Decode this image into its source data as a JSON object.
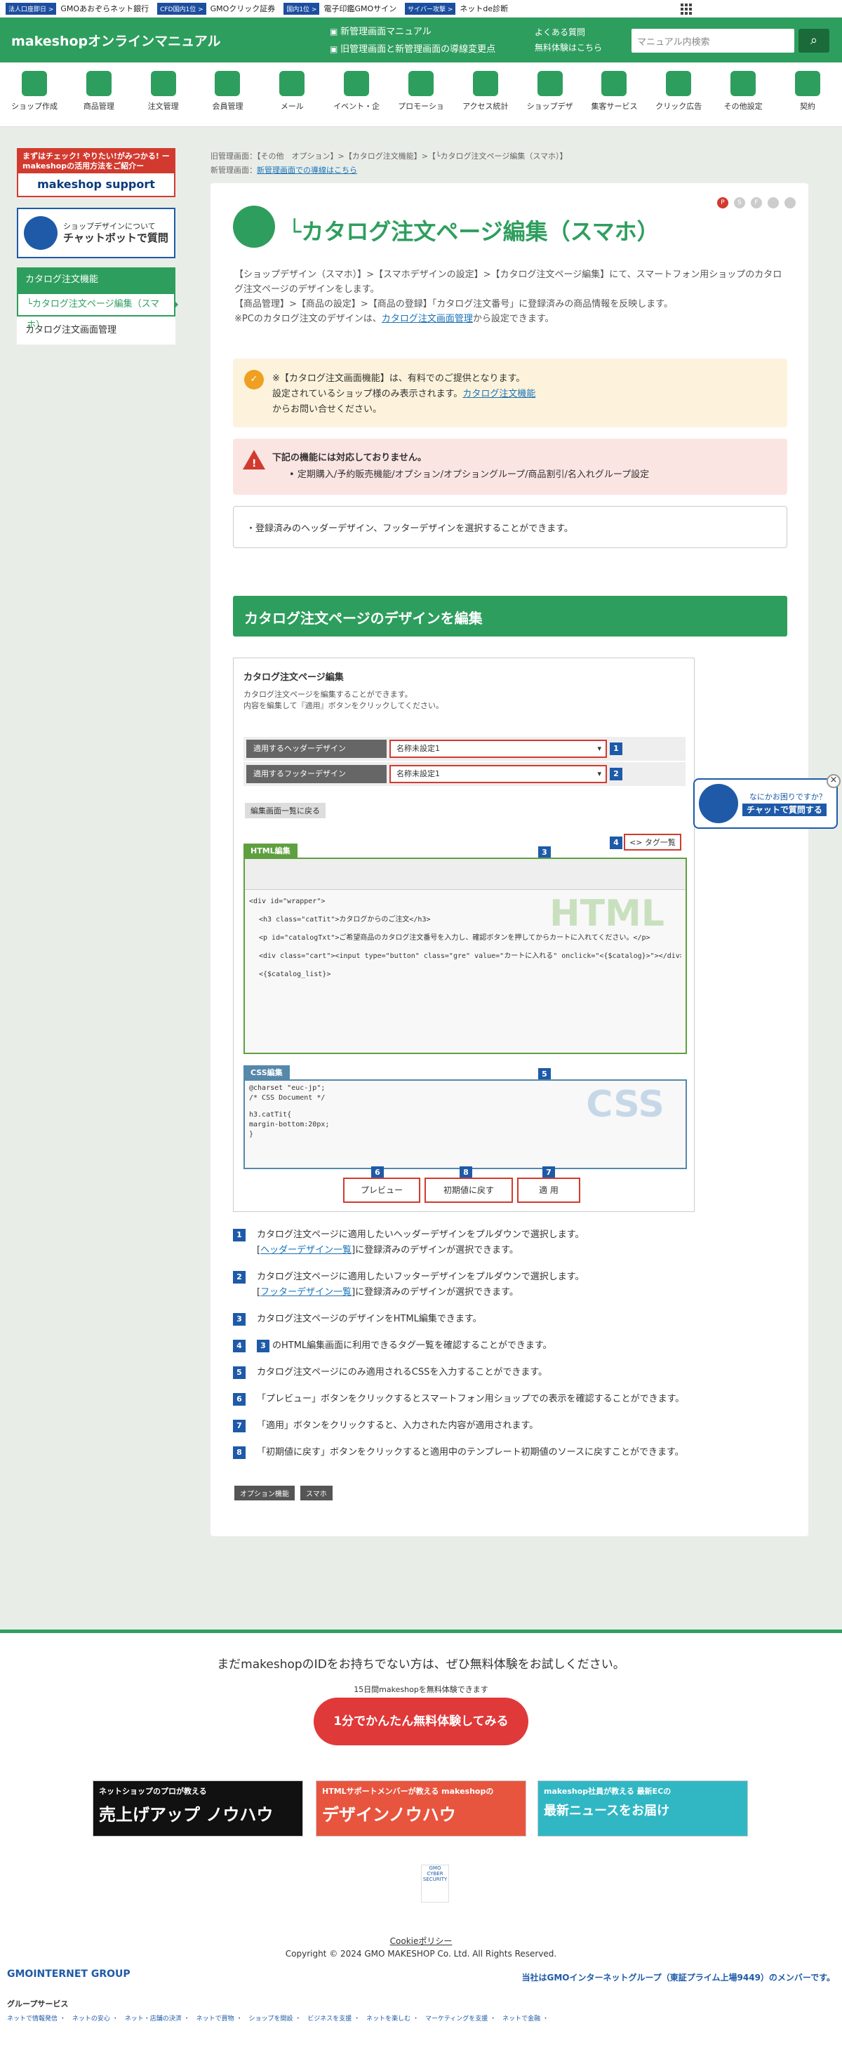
{
  "topbar": {
    "items": [
      {
        "badge": "法人口座即日 >",
        "text": "GMOあおぞらネット銀行"
      },
      {
        "badge": "CFD国内1位 >",
        "text": "GMOクリック証券"
      },
      {
        "badge": "国内1位 >",
        "text": "電子印鑑GMOサイン"
      },
      {
        "badge": "サイバー攻撃 >",
        "text": "ネットde診断"
      }
    ]
  },
  "header": {
    "logo": "makeshopオンラインマニュアル",
    "link1": "新管理画面マニュアル",
    "link2": "旧管理画面と新管理画面の導線変更点",
    "faq": "よくある質問",
    "trial": "無料体験はこちら",
    "search_placeholder": "マニュアル内検索"
  },
  "nav": [
    "ショップ作成",
    "商品管理",
    "注文管理",
    "会員管理",
    "メール",
    "イベント・企",
    "プロモーショ",
    "アクセス統計",
    "ショップデザ",
    "集客サービス",
    "クリック広告",
    "その他設定",
    "契約"
  ],
  "sidebar": {
    "banner1_top": "まずはチェック! やりたい!がみつかる! ー makeshopの活用方法をご紹介ー",
    "banner1_logo": "makeshop support",
    "banner2_line1": "ショップデザインについて",
    "banner2_line2": "チャットボットで質問",
    "menu_head": "カタログ注文機能",
    "menu_active": "└カタログ注文ページ編集（スマホ）",
    "menu_item": "カタログ注文画面管理"
  },
  "breadcrumb": {
    "line1": "旧管理画面：【その他　オプション】>【カタログ注文機能】>【└カタログ注文ページ編集（スマホ）】",
    "line2_prefix": "新管理画面：",
    "line2_link": "新管理画面での導線はこちら"
  },
  "page": {
    "title": "└カタログ注文ページ編集（スマホ）",
    "desc1": "【ショップデザイン（スマホ）】>【スマホデザインの設定】>【カタログ注文ページ編集】にて、スマートフォン用ショップのカタログ注文ページのデザインをします。",
    "desc2": "【商品管理】>【商品の設定】>【商品の登録】「カタログ注文番号」に登録済みの商品情報を反映します。",
    "desc3_prefix": "※PCのカタログ注文のデザインは、",
    "desc3_link": "カタログ注文画面管理",
    "desc3_suffix": "から設定できます。",
    "note1_l1": "※【カタログ注文画面機能】は、有料でのご提供となります。",
    "note1_l2": "設定されているショップ様のみ表示されます。",
    "note1_link": "カタログ注文機能",
    "note1_l3": "からお問い合せください。",
    "note2_title": "下記の機能には対応しておりません。",
    "note2_item": "定期購入/予約販売機能/オプション/オプショングループ/商品割引/名入れグループ設定",
    "note3": "・登録済みのヘッダーデザイン、フッターデザインを選択することができます。",
    "section": "カタログ注文ページのデザインを編集"
  },
  "shot": {
    "title": "カタログ注文ページ編集",
    "desc1": "カタログ注文ページを編集することができます。",
    "desc2": "内容を編集して『適用』ボタンをクリックしてください。",
    "hlabel": "適用するヘッダーデザイン",
    "hval": "名称未設定1",
    "flabel": "適用するフッターデザイン",
    "fval": "名称未設定1",
    "back": "編集画面一覧に戻る",
    "html_tab": "HTML編集",
    "tag_list": "<> タグ一覧",
    "html_bg": "HTML",
    "code1": "<div id=\"wrapper\">",
    "code2": "<h3 class=\"catTit\">カタログからのご注文</h3>",
    "code3": "<p id=\"catalogTxt\">ご希望商品のカタログ注文番号を入力し、確認ボタンを押してからカートに入れてください。</p>",
    "code4": "<div class=\"cart\"><input type=\"button\" class=\"gre\" value=\"カートに入れる\" onclick=\"<{$catalog}>\"></div>",
    "code5": "<{$catalog_list}>",
    "css_tab": "CSS編集",
    "css_bg": "CSS",
    "css1": "@charset \"euc-jp\";",
    "css2": "/* CSS Document */",
    "css3": "h3.catTit{",
    "css4": "  margin-bottom:20px;",
    "css5": "}",
    "preview": "プレビュー",
    "reset": "初期値に戻す",
    "apply": "適 用"
  },
  "steps": [
    {
      "n": "1",
      "t": "カタログ注文ページに適用したいヘッダーデザインをプルダウンで選択します。",
      "l": "ヘッダーデザイン一覧",
      "s": "に登録済みのデザインが選択できます。"
    },
    {
      "n": "2",
      "t": "カタログ注文ページに適用したいフッターデザインをプルダウンで選択します。",
      "l": "フッターデザイン一覧",
      "s": "に登録済みのデザインが選択できます。"
    },
    {
      "n": "3",
      "t": "カタログ注文ページのデザインをHTML編集できます。"
    },
    {
      "n": "4",
      "t": "のHTML編集画面に利用できるタグ一覧を確認することができます。"
    },
    {
      "n": "5",
      "t": "カタログ注文ページにのみ適用されるCSSを入力することができます。"
    },
    {
      "n": "6",
      "t": "「プレビュー」ボタンをクリックするとスマートフォン用ショップでの表示を確認することができます。"
    },
    {
      "n": "7",
      "t": "「適用」ボタンをクリックすると、入力された内容が適用されます。"
    },
    {
      "n": "8",
      "t": "「初期値に戻す」ボタンをクリックすると適用中のテンプレート初期値のソースに戻すことができます。"
    }
  ],
  "tags": [
    "オプション機能",
    "スマホ"
  ],
  "chat": {
    "line1": "なにかお困りですか？",
    "line2": "チャットで質問する"
  },
  "footer": {
    "cta": "まだmakeshopのIDをお持ちでない方は、ぜひ無料体験をお試しください。",
    "sub": "15日間makeshopを無料体験できます",
    "btn": "1分でかんたん無料体験してみる",
    "b1t": "ネットショップのプロが教える",
    "b1b": "売上げアップ ノウハウ",
    "b2t": "HTMLサポートメンバーが教える makeshopの",
    "b2b": "デザインノウハウ",
    "b3t": "makeshop社員が教える 最新ECの",
    "b3b": "最新ニュースをお届け",
    "cookie": "Cookieポリシー",
    "copy": "Copyright © 2024 GMO MAKESHOP Co. Ltd. All Rights Reserved.",
    "group": "GMOINTERNET GROUP",
    "member": "当社はGMOインターネットグループ（東証プライム上場9449）のメンバーです。",
    "gs": "グループサービス",
    "gs_list": "ネットで情報発信 ・　ネットの安心 ・　ネット・店舗の決済 ・　ネットで買物 ・　ショップを開設 ・　ビジネスを支援 ・　ネットを楽しむ ・　マーケティングを支援 ・　ネットで金融 ・"
  }
}
